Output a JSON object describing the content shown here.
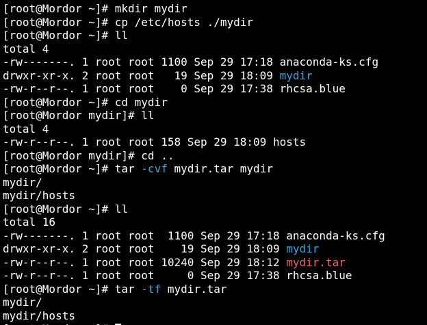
{
  "terminal": {
    "lines": [
      {
        "segments": [
          {
            "text": "[root@Mordor ~]# mkdir mydir",
            "color": "default"
          }
        ]
      },
      {
        "segments": [
          {
            "text": "[root@Mordor ~]# cp /etc/hosts ./mydir",
            "color": "default"
          }
        ]
      },
      {
        "segments": [
          {
            "text": "[root@Mordor ~]# ll",
            "color": "default"
          }
        ]
      },
      {
        "segments": [
          {
            "text": "total 4",
            "color": "default"
          }
        ]
      },
      {
        "segments": [
          {
            "text": "-rw-------. 1 root root 1100 Sep 29 17:18 anaconda-ks.cfg",
            "color": "default"
          }
        ]
      },
      {
        "segments": [
          {
            "text": "drwxr-xr-x. 2 root root   19 Sep 29 18:09 ",
            "color": "default"
          },
          {
            "text": "mydir",
            "color": "cyan"
          }
        ]
      },
      {
        "segments": [
          {
            "text": "-rw-r--r--. 1 root root    0 Sep 29 17:38 rhcsa.blue",
            "color": "default"
          }
        ]
      },
      {
        "segments": [
          {
            "text": "[root@Mordor ~]# cd mydir",
            "color": "default"
          }
        ]
      },
      {
        "segments": [
          {
            "text": "[root@Mordor mydir]# ll",
            "color": "default"
          }
        ]
      },
      {
        "segments": [
          {
            "text": "total 4",
            "color": "default"
          }
        ]
      },
      {
        "segments": [
          {
            "text": "-rw-r--r--. 1 root root 158 Sep 29 18:09 hosts",
            "color": "default"
          }
        ]
      },
      {
        "segments": [
          {
            "text": "[root@Mordor mydir]# cd ..",
            "color": "default"
          }
        ]
      },
      {
        "segments": [
          {
            "text": "[root@Mordor ~]# tar ",
            "color": "default"
          },
          {
            "text": "-cvf",
            "color": "cyan"
          },
          {
            "text": " mydir.tar mydir",
            "color": "default"
          }
        ]
      },
      {
        "segments": [
          {
            "text": "mydir/",
            "color": "default"
          }
        ]
      },
      {
        "segments": [
          {
            "text": "mydir/hosts",
            "color": "default"
          }
        ]
      },
      {
        "segments": [
          {
            "text": "[root@Mordor ~]# ll",
            "color": "default"
          }
        ]
      },
      {
        "segments": [
          {
            "text": "total 16",
            "color": "default"
          }
        ]
      },
      {
        "segments": [
          {
            "text": "-rw-------. 1 root root  1100 Sep 29 17:18 anaconda-ks.cfg",
            "color": "default"
          }
        ]
      },
      {
        "segments": [
          {
            "text": "drwxr-xr-x. 2 root root    19 Sep 29 18:09 ",
            "color": "default"
          },
          {
            "text": "mydir",
            "color": "cyan"
          }
        ]
      },
      {
        "segments": [
          {
            "text": "-rw-r--r--. 1 root root 10240 Sep 29 18:12 ",
            "color": "default"
          },
          {
            "text": "mydir.tar",
            "color": "red"
          }
        ]
      },
      {
        "segments": [
          {
            "text": "-rw-r--r--. 1 root root     0 Sep 29 17:38 rhcsa.blue",
            "color": "default"
          }
        ]
      },
      {
        "segments": [
          {
            "text": "[root@Mordor ~]# tar ",
            "color": "default"
          },
          {
            "text": "-tf",
            "color": "cyan"
          },
          {
            "text": " mydir.tar",
            "color": "default"
          }
        ]
      },
      {
        "segments": [
          {
            "text": "mydir/",
            "color": "default"
          }
        ]
      },
      {
        "segments": [
          {
            "text": "mydir/hosts",
            "color": "default"
          }
        ]
      },
      {
        "segments": [
          {
            "text": "[root@Mordor ~]# ",
            "color": "default"
          }
        ],
        "cursor": true
      }
    ]
  },
  "colors": {
    "background": "#000000",
    "default": "#ffffff",
    "cyan": "#2aa7e6",
    "red": "#f0665f"
  }
}
